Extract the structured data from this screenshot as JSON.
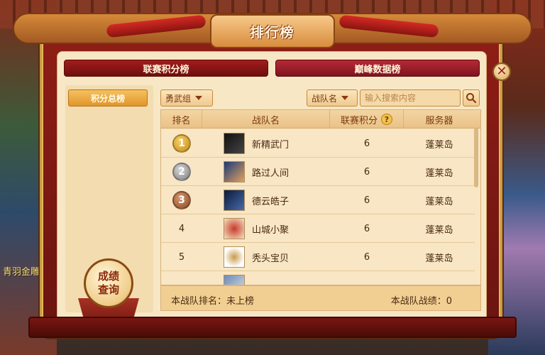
{
  "window": {
    "title": "排行榜"
  },
  "tabs": [
    {
      "label": "联赛积分榜"
    },
    {
      "label": "巅峰数据榜"
    }
  ],
  "sidebar": {
    "items": [
      {
        "label": "积分总榜"
      }
    ]
  },
  "filters": {
    "group": {
      "value": "勇武组"
    },
    "search_type": {
      "value": "战队名"
    },
    "search": {
      "placeholder": "输入搜索内容"
    }
  },
  "table": {
    "headers": {
      "rank": "排名",
      "team": "战队名",
      "score": "联赛积分",
      "server": "服务器"
    },
    "rows": [
      {
        "rank": "1",
        "team": "新精武门",
        "score": "6",
        "server": "蓬莱岛",
        "medal": "gold"
      },
      {
        "rank": "2",
        "team": "路过人间",
        "score": "6",
        "server": "蓬莱岛",
        "medal": "silver"
      },
      {
        "rank": "3",
        "team": "德云皓子",
        "score": "6",
        "server": "蓬莱岛",
        "medal": "bronze"
      },
      {
        "rank": "4",
        "team": "山城小聚",
        "score": "6",
        "server": "蓬莱岛"
      },
      {
        "rank": "5",
        "team": "秃头宝贝",
        "score": "6",
        "server": "蓬莱岛"
      }
    ]
  },
  "status": {
    "my_rank_label": "本战队排名：未上榜",
    "my_record_label": "本战队战绩：0"
  },
  "query_button": {
    "line1": "成绩",
    "line2": "查询"
  },
  "background_text": {
    "left": "青羽金雕"
  },
  "colors": {
    "gold": "#d49a1e",
    "silver": "#8a8a8a",
    "bronze": "#9a5a32",
    "accent": "#a21c1c"
  }
}
